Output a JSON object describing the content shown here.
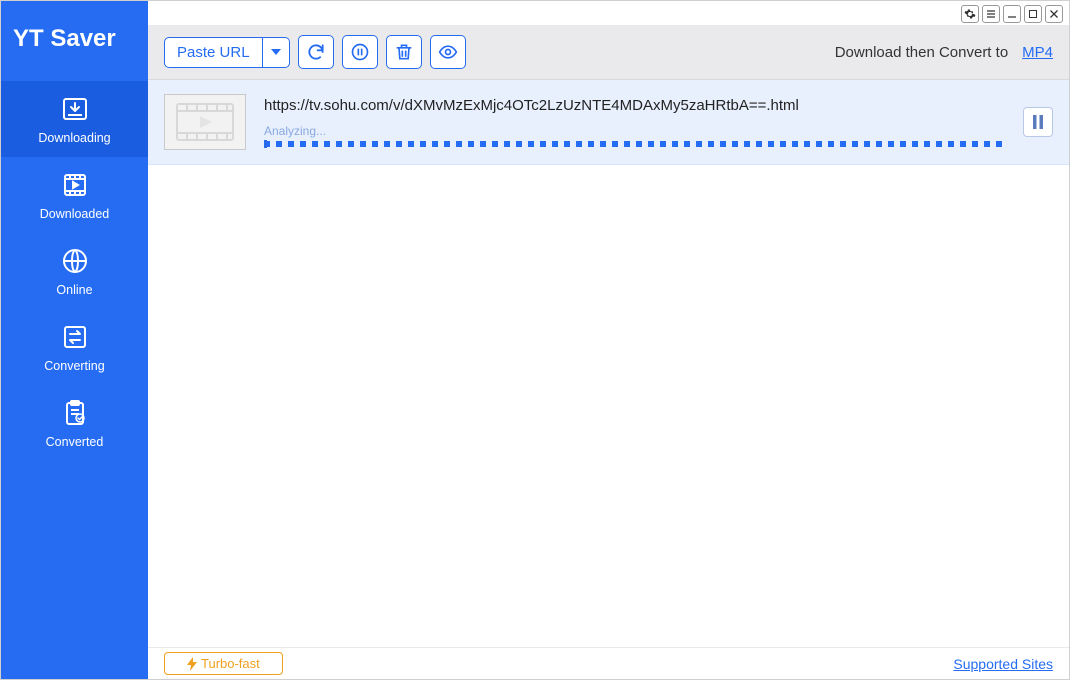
{
  "app": {
    "title": "YT Saver"
  },
  "sidebar": {
    "items": [
      {
        "label": "Downloading",
        "icon": "download-tray-icon",
        "active": true
      },
      {
        "label": "Downloaded",
        "icon": "video-file-icon",
        "active": false
      },
      {
        "label": "Online",
        "icon": "globe-icon",
        "active": false
      },
      {
        "label": "Converting",
        "icon": "convert-arrows-icon",
        "active": false
      },
      {
        "label": "Converted",
        "icon": "clipboard-check-icon",
        "active": false
      }
    ]
  },
  "toolbar": {
    "paste_label": "Paste URL",
    "convert_label": "Download then Convert to",
    "format": "MP4"
  },
  "downloads": [
    {
      "url": "https://tv.sohu.com/v/dXMvMzExMjc4OTc2LzUzNTE4MDAxMy5zaHRtbA==.html",
      "status": "Analyzing..."
    }
  ],
  "footer": {
    "turbo_label": "Turbo-fast",
    "sites_label": "Supported Sites"
  }
}
